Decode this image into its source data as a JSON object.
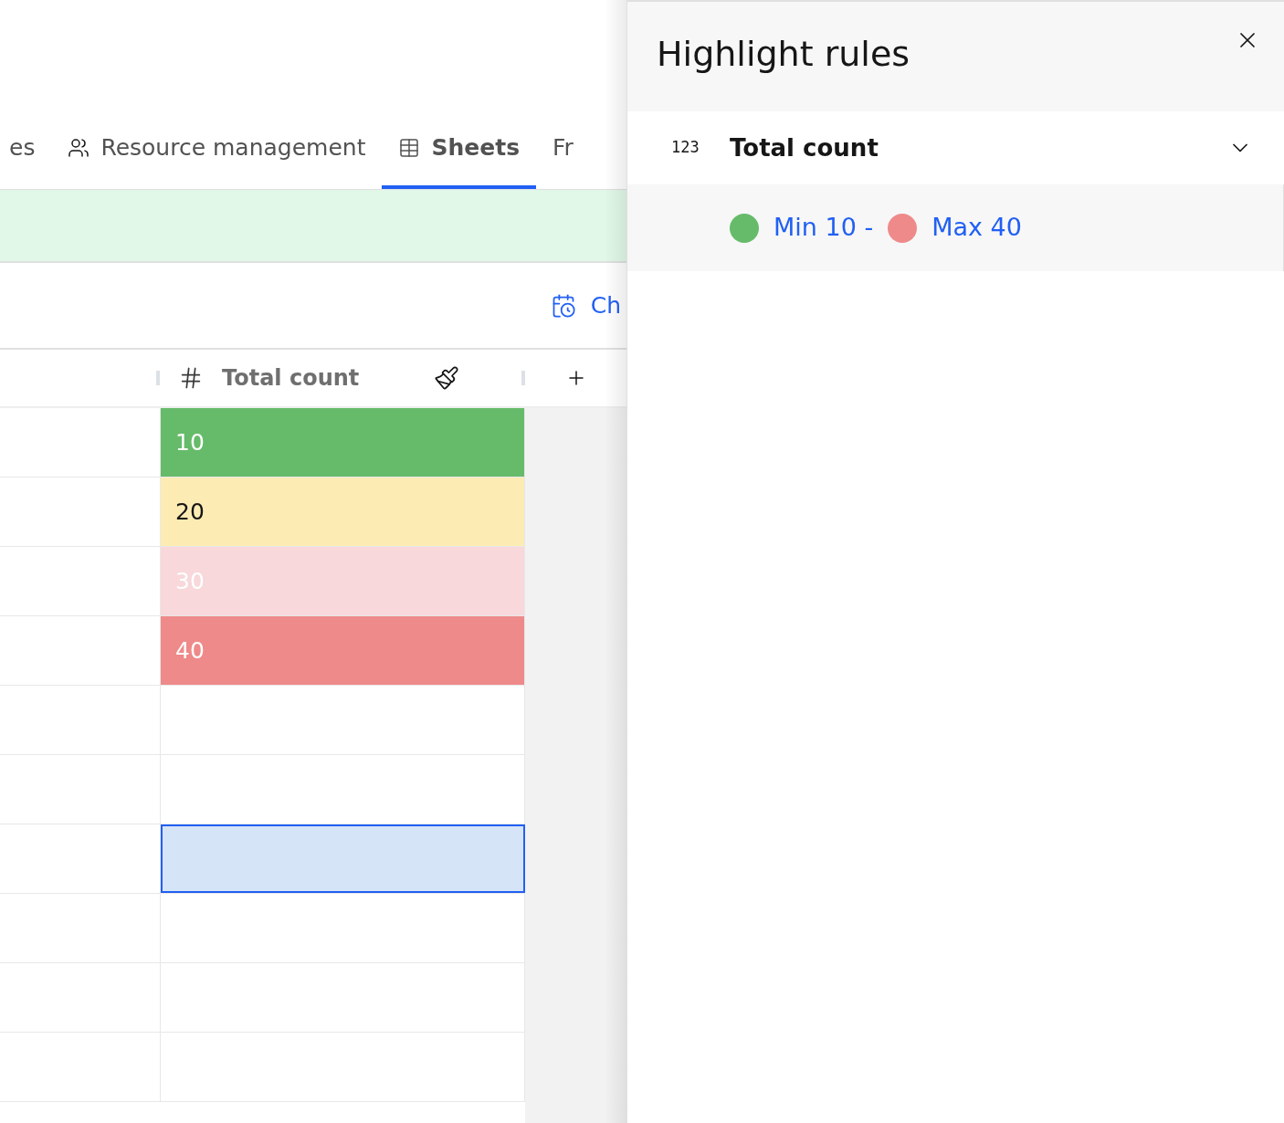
{
  "tabs": [
    {
      "label": "es",
      "kind": "plain",
      "selected": false
    },
    {
      "label": "Resource management",
      "kind": "people",
      "selected": false
    },
    {
      "label": "Sheets",
      "kind": "table",
      "selected": true
    },
    {
      "label": "Fr",
      "kind": "plain",
      "selected": false
    }
  ],
  "toolbar": {
    "action": "Ch"
  },
  "table": {
    "columns": [
      {
        "label": "Total count"
      }
    ],
    "rows": [
      {
        "value": "10",
        "color": "#66bb6a",
        "light_text": true,
        "selected": false
      },
      {
        "value": "20",
        "color": "#fcecb4",
        "light_text": false,
        "selected": false
      },
      {
        "value": "30",
        "color": "#f8d8da",
        "light_text": true,
        "selected": false
      },
      {
        "value": "40",
        "color": "#ef8a8a",
        "light_text": true,
        "selected": false
      },
      {
        "selected": false
      },
      {
        "selected": false
      },
      {
        "selected": true
      },
      {
        "selected": false
      },
      {
        "selected": false
      },
      {
        "selected": false
      }
    ]
  },
  "panel": {
    "title": "Highlight rules",
    "rule": {
      "type_label": "123",
      "field": "Total count",
      "expanded": true,
      "stops": [
        {
          "label": "Min 10 -",
          "color": "#66bb6a"
        },
        {
          "label": "Max 40",
          "color": "#ef8a8a"
        }
      ]
    }
  }
}
